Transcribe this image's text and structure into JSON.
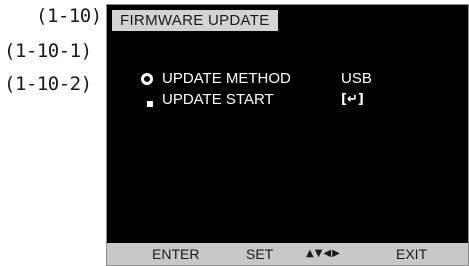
{
  "annotations": {
    "ref_1": "(1-10)",
    "ref_2": "(1-10-1)",
    "ref_3": "(1-10-2)"
  },
  "osd": {
    "title": "FIRMWARE UPDATE",
    "rows": [
      {
        "marker": "ring-icon",
        "label": "UPDATE METHOD",
        "value": "USB"
      },
      {
        "marker": "square-icon",
        "label": "UPDATE START",
        "value": "[↵]"
      }
    ],
    "footer": {
      "enter": "ENTER",
      "set": "SET",
      "arrows": "▲▼◀▶",
      "exit": "EXIT"
    },
    "colors": {
      "screen": "#000000",
      "title_bg": "#d3d3d3",
      "footer_bg": "#c8c8c8",
      "text": "#ffffff"
    }
  }
}
